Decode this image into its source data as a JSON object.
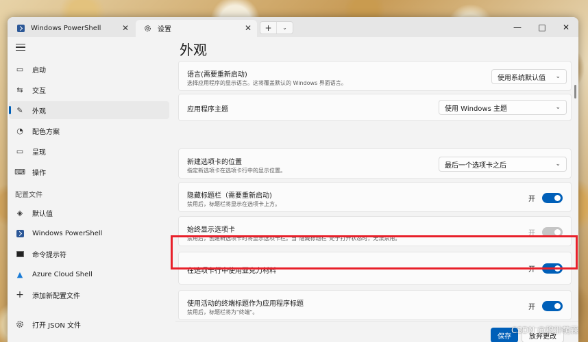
{
  "tabs": [
    {
      "label": "Windows PowerShell",
      "icon": "powershell-icon"
    },
    {
      "label": "设置",
      "icon": "gear-icon"
    }
  ],
  "newtab": {
    "plus": "+",
    "dropdown": "⌄"
  },
  "window_controls": {
    "minimize": "—",
    "maximize": "□",
    "close": "✕"
  },
  "sidebar": {
    "items": [
      {
        "label": "启动",
        "icon": "startup-icon",
        "glyph": "▭"
      },
      {
        "label": "交互",
        "icon": "interaction-icon",
        "glyph": "⇆"
      },
      {
        "label": "外观",
        "icon": "brush-icon",
        "glyph": "✎"
      },
      {
        "label": "配色方案",
        "icon": "palette-icon",
        "glyph": "◔"
      },
      {
        "label": "呈现",
        "icon": "monitor-icon",
        "glyph": "▭"
      },
      {
        "label": "操作",
        "icon": "keyboard-icon",
        "glyph": "⌨"
      }
    ],
    "profiles_label": "配置文件",
    "profiles": [
      {
        "label": "默认值",
        "icon": "layers-icon",
        "glyph": "◈"
      },
      {
        "label": "Windows PowerShell",
        "icon": "powershell-icon",
        "glyph": ""
      },
      {
        "label": "命令提示符",
        "icon": "cmd-icon",
        "glyph": "▪"
      },
      {
        "label": "Azure Cloud Shell",
        "icon": "azure-icon",
        "glyph": "▲"
      },
      {
        "label": "添加新配置文件",
        "icon": "plus-icon",
        "glyph": "+"
      }
    ],
    "open_json": "打开 JSON 文件"
  },
  "main": {
    "title": "外观",
    "settings": [
      {
        "title": "语言(需要重新启动)",
        "desc": "选择应用程序的显示语言。这将覆盖默认的 Windows 界面语言。",
        "combo": "使用系统默认值"
      },
      {
        "title": "应用程序主题",
        "combo": "使用 Windows 主题"
      },
      {
        "title": "新建选项卡的位置",
        "desc": "指定新选项卡在选项卡行中的显示位置。",
        "combo": "最后一个选项卡之后"
      },
      {
        "title": "隐藏标题栏（需要重新启动)",
        "desc": "禁用后，标题栏将显示在选项卡上方。",
        "toggle": "开",
        "on": true
      },
      {
        "title": "始终显示选项卡",
        "desc": "禁用后，创建新选项卡时将显示选项卡栏。当\"隐藏标题栏\"处于打开状态时，无法禁用。",
        "toggle": "开",
        "on": true,
        "disabled": true
      },
      {
        "title": "在选项卡行中使用亚克力材料",
        "toggle": "开",
        "on": true
      },
      {
        "title": "使用活动的终端标题作为应用程序标题",
        "desc": "禁用后，标题栏将为\"终端\"。",
        "toggle": "开",
        "on": true
      }
    ]
  },
  "footer": {
    "save": "保存",
    "discard": "放弃更改"
  },
  "watermark": "CSDN @穆翀萌霖",
  "colors": {
    "accent": "#005fb8",
    "highlight": "#e8202a"
  }
}
